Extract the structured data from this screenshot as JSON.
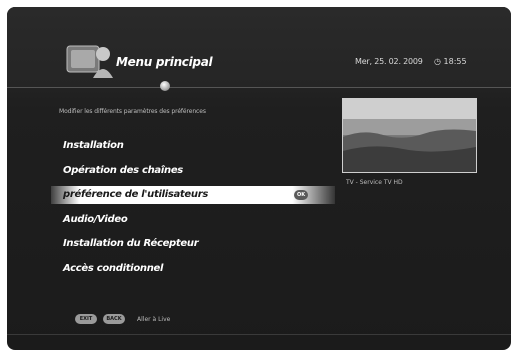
{
  "header": {
    "title": "Menu principal",
    "date": "Mer, 25. 02. 2009",
    "time": "18:55",
    "clock_icon": "clock-icon"
  },
  "main": {
    "subtitle": "Modifier les différents paramètres des préférences",
    "menu_items": [
      {
        "label": "Installation"
      },
      {
        "label": "Opération des chaînes"
      },
      {
        "label": "préférence de l'utilisateurs",
        "selected": true,
        "badge": "OK"
      },
      {
        "label": "Audio/Video"
      },
      {
        "label": "Installation du Récepteur"
      },
      {
        "label": "Accès conditionnel"
      }
    ]
  },
  "preview": {
    "channel": "TV - Service TV HD"
  },
  "footer": {
    "exit_label": "EXIT",
    "back_label": "BACK",
    "hint": "Aller à Live"
  },
  "colors": {
    "background": "#1b1b1b",
    "text": "#ffffff",
    "highlight": "#ffffff",
    "muted_text": "#bdbdbd"
  }
}
